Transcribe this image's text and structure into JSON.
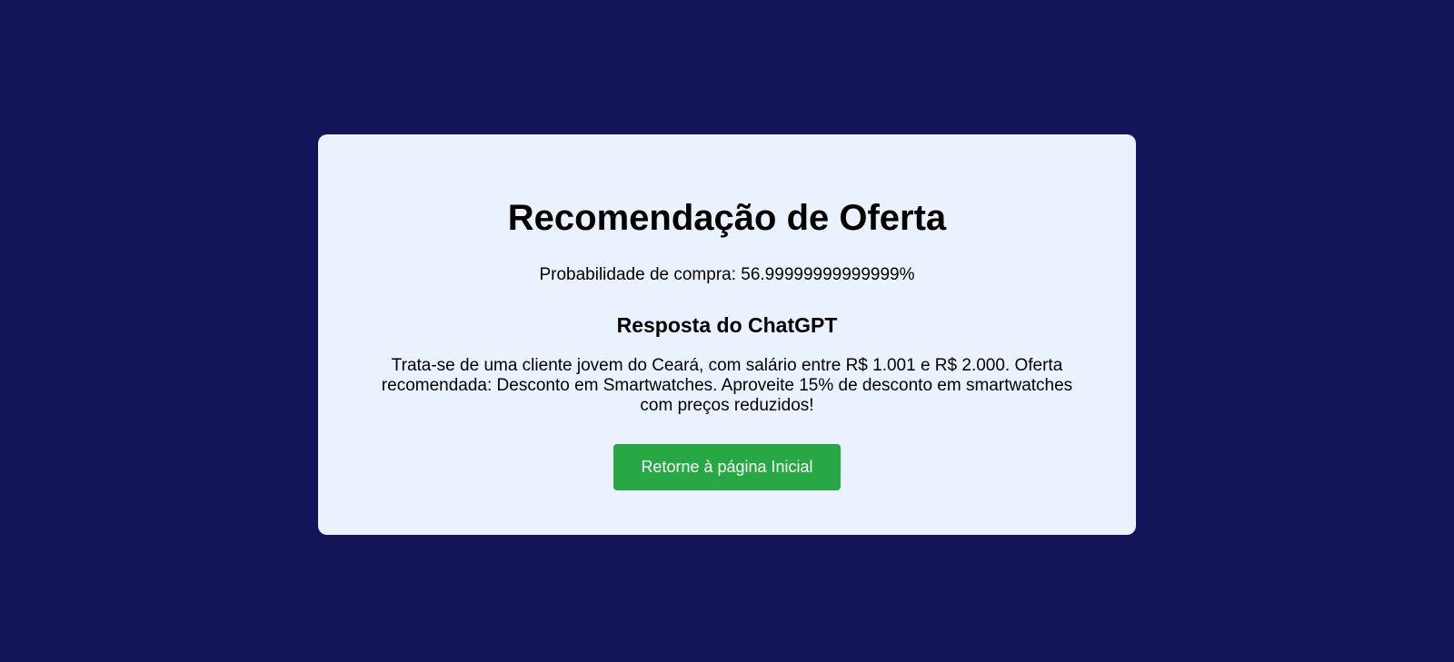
{
  "card": {
    "title": "Recomendação de Oferta",
    "probability_text": "Probabilidade de compra: 56.99999999999999%",
    "response_heading": "Resposta do ChatGPT",
    "response_text": "Trata-se de uma cliente jovem do Ceará, com salário entre R$ 1.001 e R$ 2.000. Oferta recomendada: Desconto em Smartwatches. Aproveite 15% de desconto em smartwatches com preços reduzidos!",
    "button_label": "Retorne à página Inicial"
  },
  "colors": {
    "background": "#131558",
    "card": "#eaf2fd",
    "button": "#28a745",
    "button_text": "#ffffff"
  }
}
